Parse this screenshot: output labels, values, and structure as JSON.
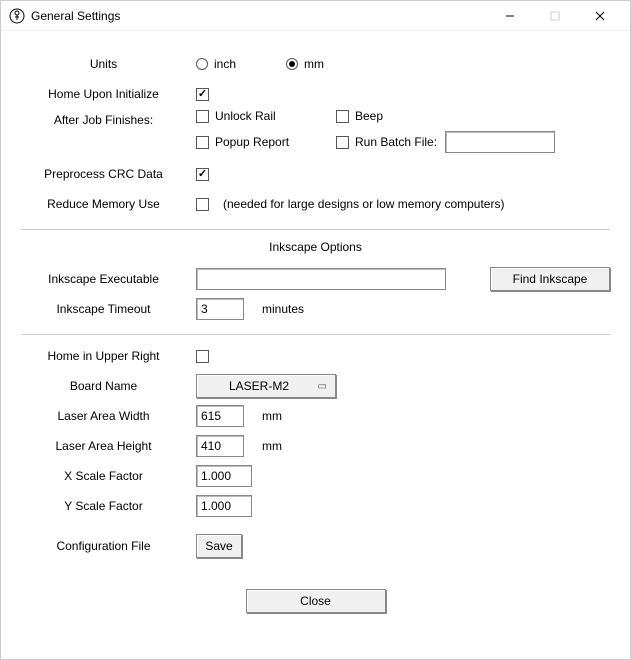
{
  "window": {
    "title": "General Settings"
  },
  "labels": {
    "units": "Units",
    "home_init": "Home Upon Initialize",
    "after_job": "After Job Finishes:",
    "preprocess": "Preprocess CRC Data",
    "reduce_mem": "Reduce Memory Use",
    "reduce_mem_hint": "(needed for large designs or low memory computers)",
    "inkscape_section": "Inkscape Options",
    "inkscape_exe": "Inkscape Executable",
    "inkscape_timeout": "Inkscape Timeout",
    "minutes": "minutes",
    "home_upper_right": "Home in Upper Right",
    "board_name": "Board Name",
    "laser_w": "Laser Area Width",
    "laser_h": "Laser Area Height",
    "xscale": "X Scale Factor",
    "yscale": "Y Scale Factor",
    "config_file": "Configuration File",
    "mm_unit": "mm"
  },
  "radios": {
    "units_inch": "inch",
    "units_mm": "mm",
    "selected": "mm"
  },
  "checks": {
    "home_init": true,
    "unlock_rail": {
      "label": "Unlock Rail",
      "checked": false
    },
    "beep": {
      "label": "Beep",
      "checked": false
    },
    "popup_report": {
      "label": "Popup Report",
      "checked": false
    },
    "run_batch": {
      "label": "Run Batch File:",
      "checked": false
    },
    "preprocess": true,
    "reduce_mem": false,
    "home_upper_right": false
  },
  "inputs": {
    "batch_path": "",
    "inkscape_exe": "",
    "inkscape_timeout": "3",
    "board_name": "LASER-M2",
    "laser_w": "615",
    "laser_h": "410",
    "xscale": "1.000",
    "yscale": "1.000"
  },
  "buttons": {
    "find_inkscape": "Find Inkscape",
    "save": "Save",
    "close": "Close"
  }
}
